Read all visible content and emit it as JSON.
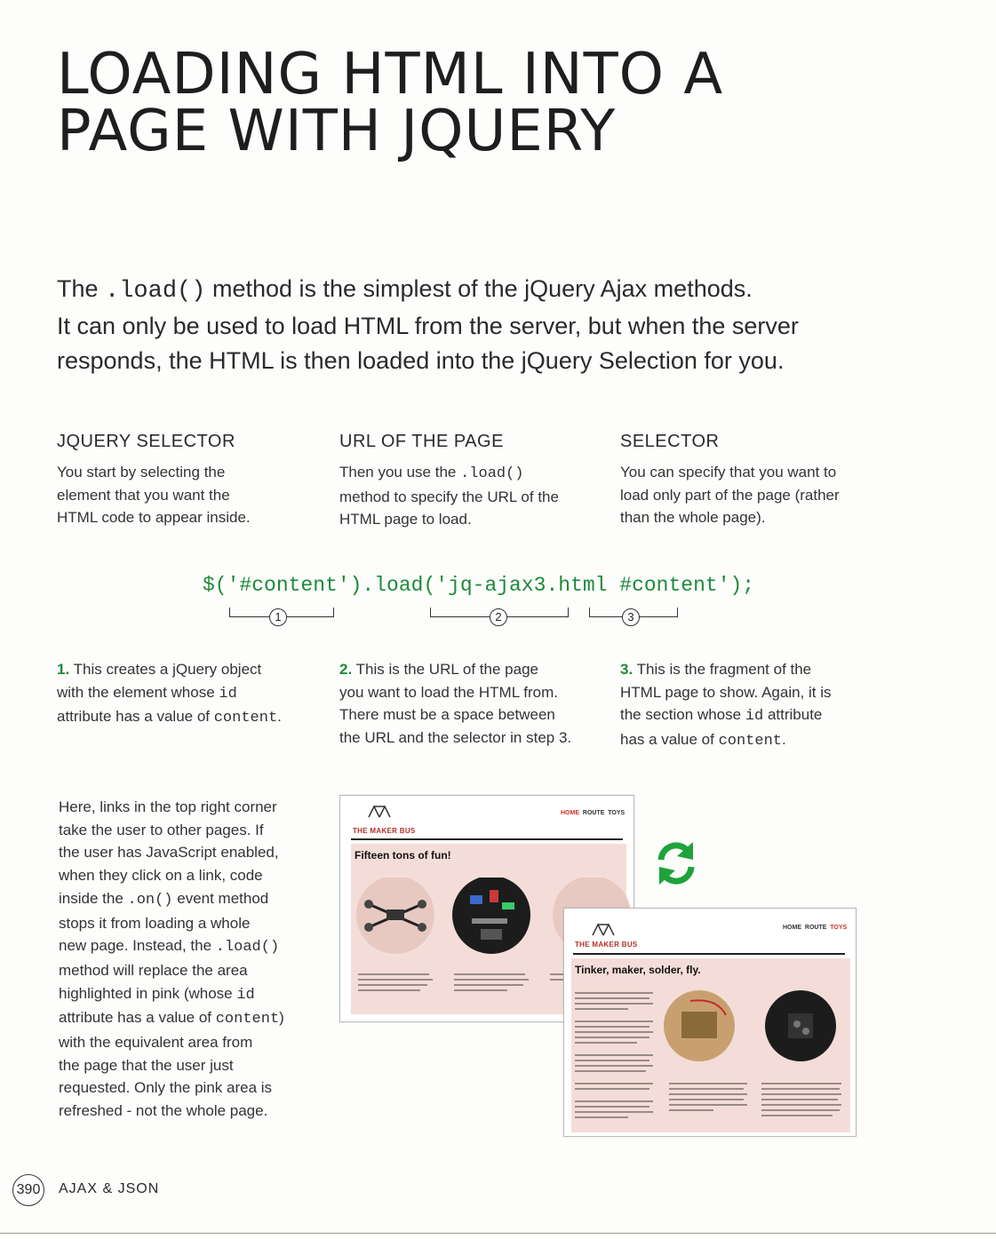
{
  "title": {
    "line1": "LOADING HTML INTO A",
    "line2": "PAGE WITH JQUERY"
  },
  "intro": {
    "l1_a": "The ",
    "l1_code": ".load()",
    "l1_b": " method is the simplest of the jQuery Ajax methods.",
    "line2": "It can only be used to load HTML from the server, but when the server",
    "line3": "responds, the HTML is then loaded into the jQuery Selection for you."
  },
  "columns": [
    {
      "heading": "JQUERY SELECTOR",
      "l1": "You start by selecting the",
      "l2": "element that you want the",
      "l3": "HTML code to appear inside."
    },
    {
      "heading": "URL OF THE PAGE",
      "l1_a": "Then you use the ",
      "l1_code": ".load()",
      "l2": "method to specify the URL of the",
      "l3": "HTML page to load."
    },
    {
      "heading": "SELECTOR",
      "l1": "You can specify that you want to",
      "l2": "load only part of the page (rather",
      "l3": "than the whole page)."
    }
  ],
  "code": "$('#content').load('jq-ajax3.html #content');",
  "markers": [
    "1",
    "2",
    "3"
  ],
  "steps": [
    {
      "num": "1.",
      "l1": " This creates a jQuery object",
      "l2": "with the element whose ",
      "l2_code": "id",
      "l3": "attribute has a value of ",
      "l3_code": "content",
      "l3_end": "."
    },
    {
      "num": "2.",
      "l1": " This is the URL of the page",
      "l2": "you want to load the HTML from.",
      "l3": "There must be a space between",
      "l4": "the URL and the selector in step 3."
    },
    {
      "num": "3.",
      "l1": " This is the fragment of the",
      "l2": "HTML page to show. Again, it is",
      "l3_a": "the section whose ",
      "l3_code": "id",
      "l3_b": " attribute",
      "l4": "has a value of ",
      "l4_code": "content",
      "l4_end": "."
    }
  ],
  "side_text": {
    "l1": "Here, links in the top right corner",
    "l2": "take the user to other pages. If",
    "l3": "the user has JavaScript enabled,",
    "l4": "when they click on a link, code",
    "l5_a": "inside the ",
    "l5_code": ".on()",
    "l5_b": " event method",
    "l6": "stops it from loading a whole",
    "l7_a": "new page. Instead, the ",
    "l7_code": ".load()",
    "l8": "method will replace the area",
    "l9_a": "highlighted in pink (whose ",
    "l9_code": "id",
    "l10_a": "attribute has a value of ",
    "l10_code": "content",
    "l10_b": ")",
    "l11": "with the equivalent area from",
    "l12": "the page that the user just",
    "l13": "requested. Only the pink area is",
    "l14": "refreshed - not the whole page."
  },
  "screenshot1": {
    "logo": "THE MAKER BUS",
    "nav": [
      "HOME",
      "ROUTE",
      "TOYS"
    ],
    "heading": "Fifteen tons of fun!"
  },
  "screenshot2": {
    "logo": "THE MAKER BUS",
    "nav": [
      "HOME",
      "ROUTE",
      "TOYS"
    ],
    "heading": "Tinker, maker, solder, fly."
  },
  "footer": {
    "page": "390",
    "label": "AJAX & JSON"
  },
  "colors": {
    "code": "#1d8a3a",
    "refresh": "#1ea33c",
    "pink": "#f4ddd8"
  }
}
